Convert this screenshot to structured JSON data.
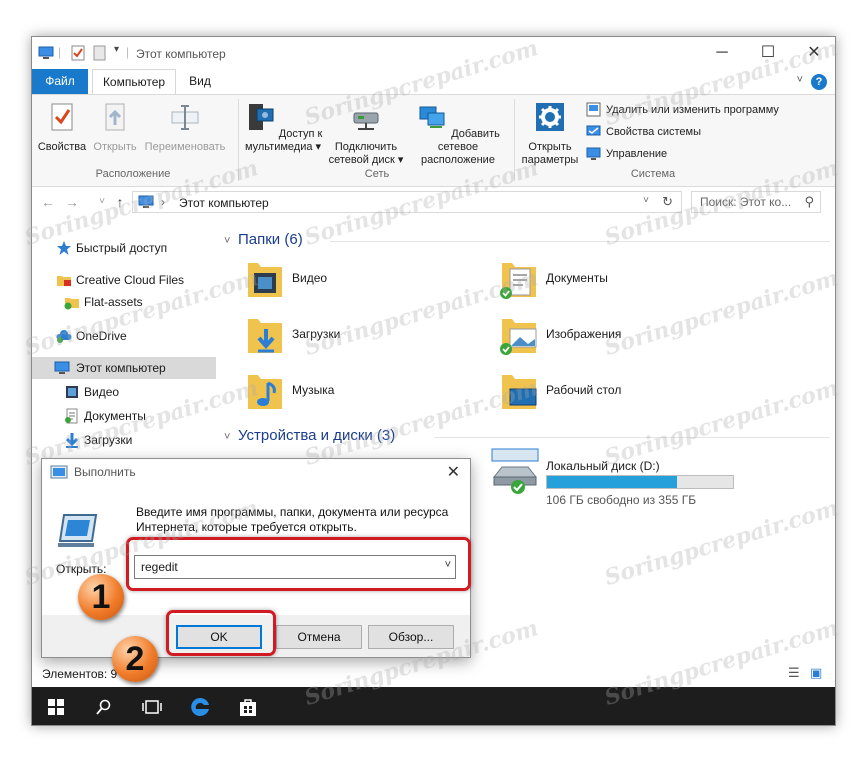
{
  "window": {
    "title": "Этот компьютер"
  },
  "ribbon": {
    "tabs": [
      {
        "label": "Файл"
      },
      {
        "label": "Компьютер"
      },
      {
        "label": "Вид"
      }
    ],
    "help_label": "?",
    "location_group": {
      "label": "Расположение",
      "properties": "Свойства",
      "open": "Открыть",
      "rename": "Переименовать"
    },
    "network_group": {
      "label": "Сеть",
      "media_line1": "Доступ к",
      "media_line2": "мультимедиа ▾",
      "map_line1": "Подключить",
      "map_line2": "сетевой диск ▾",
      "addnet_line1": "Добавить сетевое",
      "addnet_line2": "расположение"
    },
    "system_group": {
      "label": "Система",
      "settings_line1": "Открыть",
      "settings_line2": "параметры",
      "uninstall": "Удалить или изменить программу",
      "sysprops": "Свойства системы",
      "manage": "Управление"
    }
  },
  "address_bar": {
    "path": "Этот компьютер",
    "separator": "›",
    "search_placeholder": "Поиск: Этот ко..."
  },
  "nav_pane": {
    "items": [
      {
        "label": "Быстрый доступ"
      },
      {
        "label": "Creative Cloud Files"
      },
      {
        "label": "Flat-assets"
      },
      {
        "label": "OneDrive"
      },
      {
        "label": "Этот компьютер"
      },
      {
        "label": "Видео"
      },
      {
        "label": "Документы"
      },
      {
        "label": "Загрузки"
      }
    ]
  },
  "content": {
    "folders_header": "Папки (6)",
    "folders": [
      {
        "label": "Видео"
      },
      {
        "label": "Документы"
      },
      {
        "label": "Загрузки"
      },
      {
        "label": "Изображения"
      },
      {
        "label": "Музыка"
      },
      {
        "label": "Рабочий стол"
      }
    ],
    "devices_header": "Устройства и диски (3)",
    "drive": {
      "label": "Локальный диск (D:)",
      "free_text": "106 ГБ свободно из 355 ГБ",
      "used_fraction": 0.7
    }
  },
  "status_bar": {
    "items_text": "Элементов: 9"
  },
  "run_dialog": {
    "title": "Выполнить",
    "description": "Введите имя программы, папки, документа или ресурса Интернета, которые требуется открыть.",
    "open_label": "Открыть:",
    "input_value": "regedit",
    "ok_label": "OK",
    "cancel_label": "Отмена",
    "browse_label": "Обзор..."
  },
  "annotations": {
    "step1": "1",
    "step2": "2"
  },
  "watermark": "Soringpcrepair.com",
  "colors": {
    "accent": "#1979ca",
    "highlight_red": "#d21a22",
    "badge_orange": "#f07c2a",
    "disk_bar": "#26a0da"
  }
}
